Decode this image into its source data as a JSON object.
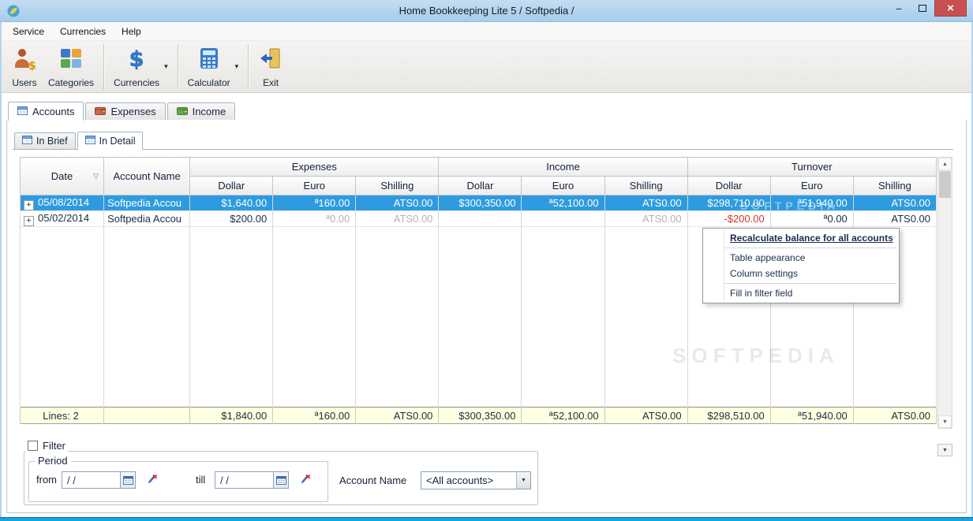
{
  "window": {
    "title": "Home Bookkeeping Lite 5  / Softpedia /",
    "minimize_glyph": "–",
    "close_glyph": "×"
  },
  "menubar": {
    "items": [
      "Service",
      "Currencies",
      "Help"
    ]
  },
  "toolbar": {
    "users": "Users",
    "categories": "Categories",
    "currencies": "Currencies",
    "calculator": "Calculator",
    "exit": "Exit"
  },
  "tabs": {
    "accounts": "Accounts",
    "expenses": "Expenses",
    "income": "Income"
  },
  "subtabs": {
    "in_brief": "In Brief",
    "in_detail": "In Detail"
  },
  "table": {
    "headers": {
      "date": "Date",
      "account": "Account Name",
      "groups": [
        "Expenses",
        "Income",
        "Turnover"
      ],
      "currencies": [
        "Dollar",
        "Euro",
        "Shilling"
      ]
    },
    "rows": [
      {
        "date": "05/08/2014",
        "account": "Softpedia Accou",
        "exp_dollar": "$1,640.00",
        "exp_euro": "ª160.00",
        "exp_shilling": "ATS0.00",
        "inc_dollar": "$300,350.00",
        "inc_euro": "ª52,100.00",
        "inc_shilling": "ATS0.00",
        "turn_dollar": "$298,710.00",
        "turn_euro": "ª51,940.00",
        "turn_shilling": "ATS0.00"
      },
      {
        "date": "05/02/2014",
        "account": "Softpedia Accou",
        "exp_dollar": "$200.00",
        "exp_euro": "ª0.00",
        "exp_shilling": "ATS0.00",
        "inc_dollar": "",
        "inc_euro": "",
        "inc_shilling": "ATS0.00",
        "turn_dollar": "-$200.00",
        "turn_euro": "ª0.00",
        "turn_shilling": "ATS0.00"
      }
    ],
    "totals": {
      "lines": "Lines: 2",
      "exp_dollar": "$1,840.00",
      "exp_euro": "ª160.00",
      "exp_shilling": "ATS0.00",
      "inc_dollar": "$300,350.00",
      "inc_euro": "ª52,100.00",
      "inc_shilling": "ATS0.00",
      "turn_dollar": "$298,510.00",
      "turn_euro": "ª51,940.00",
      "turn_shilling": "ATS0.00"
    }
  },
  "context_menu": {
    "items": [
      "Recalculate balance for all accounts",
      "Table appearance",
      "Column settings",
      "Fill in filter field"
    ]
  },
  "filter": {
    "filter_label": "Filter",
    "period_label": "Period",
    "from_label": "from",
    "till_label": "till",
    "date_value": "/  /",
    "account_label": "Account Name",
    "account_value": "<All accounts>"
  },
  "icons": {
    "sort_desc": "▽",
    "expand": "+",
    "scroll_up": "▲",
    "scroll_down": "▼",
    "dropdown": "▾",
    "combo_arrow": "▼"
  },
  "watermark": "SOFTPEDIA",
  "colors": {
    "selection": "#2e9be0",
    "negative": "#d8372b",
    "totals_bg": "#ffffe1",
    "titlebar": "#a5cdeb",
    "close_button": "#c75050"
  }
}
